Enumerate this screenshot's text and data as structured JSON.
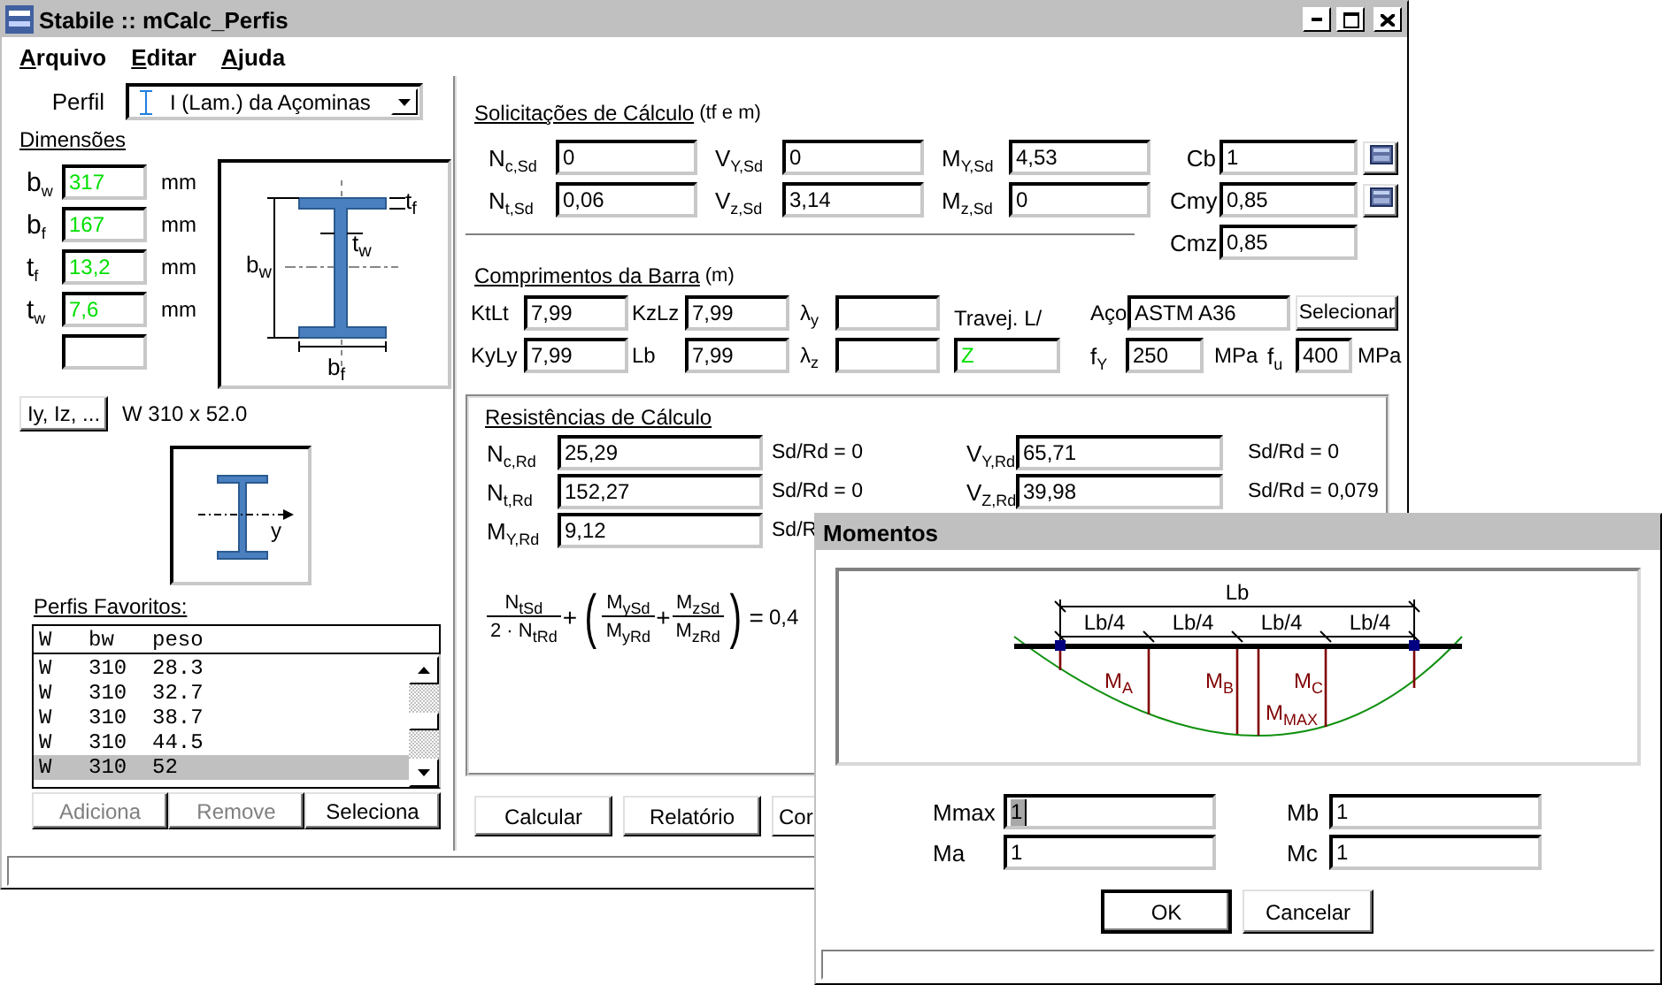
{
  "window": {
    "title": "Stabile :: mCalc_Perfis"
  },
  "menu": [
    {
      "mnemonic": "A",
      "rest": "rquivo"
    },
    {
      "mnemonic": "E",
      "rest": "ditar"
    },
    {
      "mnemonic": "A",
      "rest": "juda"
    }
  ],
  "perfil": {
    "label": "Perfil",
    "value": "I (Lam.) da Açominas"
  },
  "dimensoes": {
    "title": "Dimensões",
    "fields": [
      {
        "kind": "dimension",
        "label": "b$_{w}$",
        "value": "317",
        "unit": "mm"
      },
      {
        "kind": "dimension",
        "label": "b$_{f}$",
        "value": "167",
        "unit": "mm"
      },
      {
        "kind": "dimension",
        "label": "t$_{f}$",
        "value": "13,2",
        "unit": "mm"
      },
      {
        "kind": "dimension",
        "label": "t$_{w}$",
        "value": "7,6",
        "unit": "mm"
      },
      {
        "kind": "blank"
      }
    ]
  },
  "section_drawing": {
    "labels": [
      {
        "main": "t",
        "sub": "f"
      },
      {
        "main": "t",
        "sub": "w"
      },
      {
        "main": "b",
        "sub": "w"
      },
      {
        "main": "b",
        "sub": "f"
      }
    ]
  },
  "properties_button": "Iy, Iz, ...",
  "profile_name": "W 310 x 52.0",
  "axis_drawing": {
    "axis_label": "y"
  },
  "favoritos": {
    "title": "Perfis Favoritos:",
    "columns": [
      "W",
      "bw",
      "peso"
    ],
    "rows": [
      {
        "cells": [
          "W",
          "310",
          "28.3"
        ],
        "selected": false
      },
      {
        "cells": [
          "W",
          "310",
          "32.7"
        ],
        "selected": false
      },
      {
        "cells": [
          "W",
          "310",
          "38.7"
        ],
        "selected": false
      },
      {
        "cells": [
          "W",
          "310",
          "44.5"
        ],
        "selected": false
      },
      {
        "cells": [
          "W",
          "310",
          "52"
        ],
        "selected": true
      }
    ]
  },
  "favoritos_buttons": [
    {
      "label": "Adiciona",
      "disabled": true
    },
    {
      "label": "Remove",
      "disabled": true
    },
    {
      "label": "Seleciona",
      "disabled": false
    }
  ],
  "solicitacoes": {
    "title": "Solicitações de Cálculo",
    "unit": "(tf e m)",
    "rows": [
      [
        {
          "label": "N$_{c,Sd}$",
          "value": "0"
        },
        {
          "label": "V$_{Y,Sd}$",
          "value": "0"
        },
        {
          "label": "M$_{Y,Sd}$",
          "value": "4,53"
        }
      ],
      [
        {
          "label": "N$_{t,Sd}$",
          "value": "0,06"
        },
        {
          "label": "V$_{z,Sd}$",
          "value": "3,14"
        },
        {
          "label": "M$_{z,Sd}$",
          "value": "0"
        }
      ]
    ],
    "coefficients": [
      {
        "label": "Cb",
        "value": "1",
        "calculator": true
      },
      {
        "label": "Cmy",
        "value": "0,85",
        "calculator": true
      },
      {
        "label": "Cmz",
        "value": "0,85",
        "calculator": false
      }
    ]
  },
  "comprimentos": {
    "title": "Comprimentos da Barra",
    "unit": "(m)",
    "rows": [
      [
        {
          "label": "KtLt",
          "value": "7,99"
        },
        {
          "label": "KzLz",
          "value": "7,99"
        },
        {
          "label": "λ$_{y}$"
        }
      ],
      [
        {
          "label": "KyLy",
          "value": "7,99"
        },
        {
          "label": "Lb",
          "value": "7,99"
        },
        {
          "label": "λ$_{z}$"
        }
      ]
    ],
    "travejamento": {
      "label": "Travej. L/",
      "value": "Z"
    },
    "aco": {
      "label": "Aço",
      "value": "ASTM A36",
      "button": "Selecionar"
    },
    "fy": {
      "label": "f$_{Y}$",
      "value": "250",
      "unit": "MPa"
    },
    "fu": {
      "label": "f$_{u}$",
      "value": "400",
      "unit": "MPa"
    }
  },
  "resistencias": {
    "title": "Resistências de Cálculo",
    "rows": [
      [
        {
          "label": "N$_{c,Rd}$",
          "value": "25,29",
          "ratio": "Sd/Rd = 0"
        },
        {
          "label": "V$_{Y,Rd}$",
          "value": "65,71",
          "ratio": "Sd/Rd = 0"
        }
      ],
      [
        {
          "label": "N$_{t,Rd}$",
          "value": "152,27",
          "ratio": "Sd/Rd = 0"
        },
        {
          "label": "V$_{Z,Rd}$",
          "value": "39,98",
          "ratio": "Sd/Rd = 0,079"
        }
      ],
      [
        {
          "label": "M$_{Y,Rd}$",
          "value": "9,12",
          "ratio": "Sd/R"
        }
      ]
    ],
    "formula": {
      "terms": [
        {
          "num": "N$_{tSd}$",
          "den": "2 · N$_{tRd}$"
        },
        {
          "num": "M$_{ySd}$",
          "den": "M$_{yRd}$"
        },
        {
          "num": "M$_{zSd}$",
          "den": "M$_{zRd}$"
        }
      ],
      "operators": [
        "+",
        "+"
      ],
      "open": "(",
      "close": ")",
      "equals": "=",
      "result": "0,4"
    }
  },
  "actions": [
    "Calcular",
    "Relatório",
    "Cor"
  ],
  "dialog": {
    "title": "Momentos",
    "diagram": {
      "span_label": "Lb",
      "segment_labels": [
        "Lb/4",
        "Lb/4",
        "Lb/4",
        "Lb/4"
      ],
      "moment_labels": [
        {
          "main": "M",
          "sub": "A"
        },
        {
          "main": "M",
          "sub": "B"
        },
        {
          "main": "M",
          "sub": "C"
        },
        {
          "main": "M",
          "sub": "MAX"
        }
      ]
    },
    "fields": [
      {
        "label": "Mmax",
        "value": "1",
        "focused": true
      },
      {
        "label": "Mb",
        "value": "1",
        "focused": false
      },
      {
        "label": "Ma",
        "value": "1",
        "focused": false
      },
      {
        "label": "Mc",
        "value": "1",
        "focused": false
      }
    ],
    "buttons": [
      {
        "label": "OK",
        "default": true
      },
      {
        "label": "Cancelar",
        "default": false
      }
    ]
  }
}
